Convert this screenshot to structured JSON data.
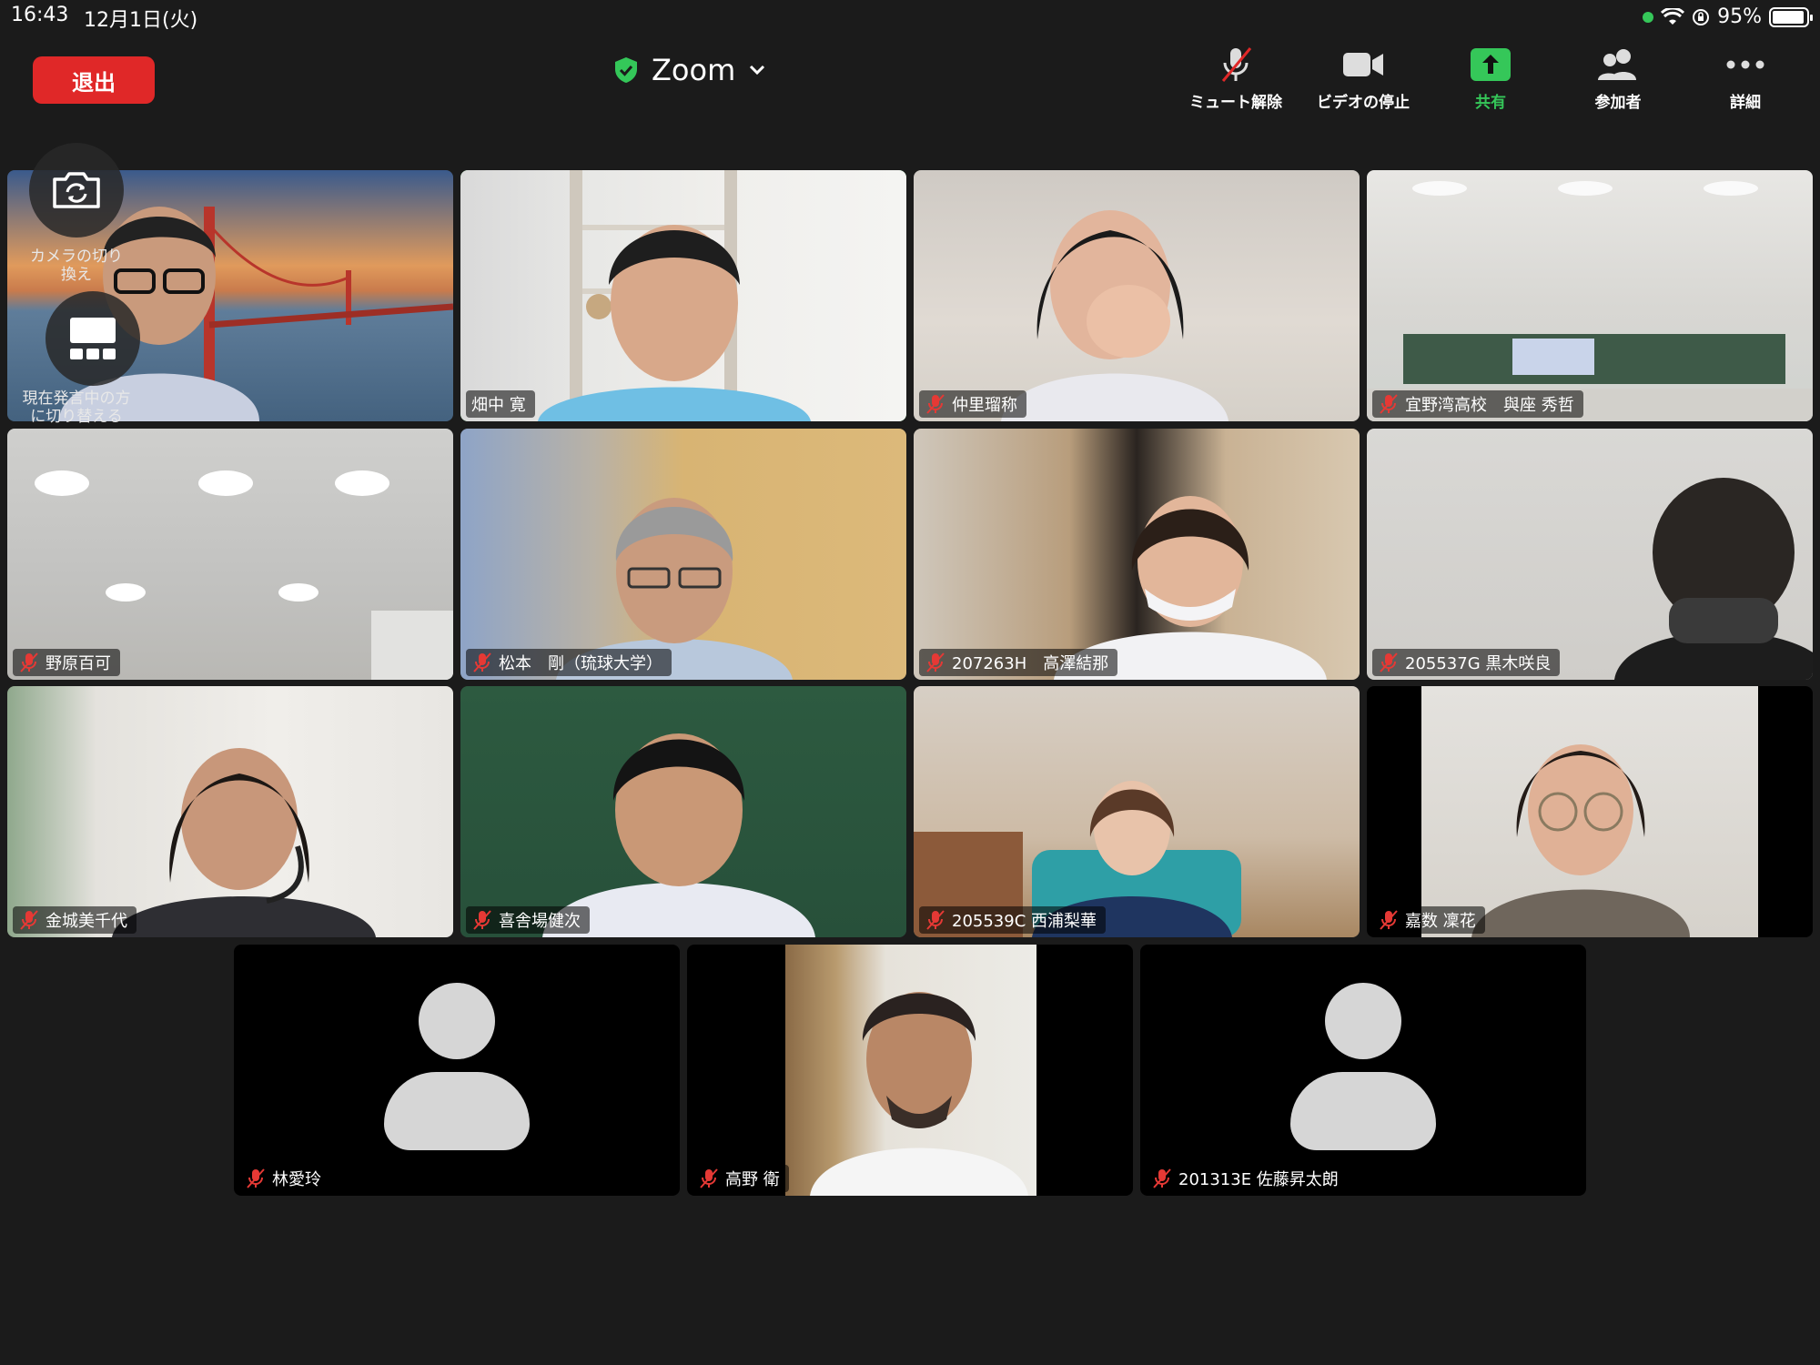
{
  "status_bar": {
    "time": "16:43",
    "date": "12月1日(火)",
    "battery": "95%",
    "battery_level": 0.95
  },
  "top_bar": {
    "leave_label": "退出",
    "title": "Zoom",
    "tools": [
      {
        "icon": "mic-muted-icon",
        "label": "ミュート解除"
      },
      {
        "icon": "video-camera-icon",
        "label": "ビデオの停止"
      },
      {
        "icon": "share-up-arrow-icon",
        "label": "共有"
      },
      {
        "icon": "participants-icon",
        "label": "参加者"
      },
      {
        "icon": "more-dots-icon",
        "label": "詳細"
      }
    ]
  },
  "overlay": {
    "camera_switch_label": "カメラの切り換え",
    "speaker_view_label": "現在発言中の方に切り替える"
  },
  "participants": [
    {
      "name": "仲里瑠称"
    },
    {
      "name": "宜野湾高校　與座 秀哲"
    },
    {
      "name": "畑中 寛"
    },
    {
      "name": "野原百可"
    },
    {
      "name": "松本　剛（琉球大学）"
    },
    {
      "name": "207263H　高澤結那"
    },
    {
      "name": "205537G 黒木咲良"
    },
    {
      "name": "金城美千代"
    },
    {
      "name": "喜舎場健次"
    },
    {
      "name": "205539C 西浦梨華"
    },
    {
      "name": "嘉数 凜花"
    },
    {
      "name": "林愛玲"
    },
    {
      "name": "高野 衛"
    },
    {
      "name": "201313E 佐藤昇太朗"
    }
  ],
  "colors": {
    "leave": "#e02828",
    "active_speaker": "#34c759",
    "share": "#35c759",
    "background": "#1b1b1b"
  }
}
